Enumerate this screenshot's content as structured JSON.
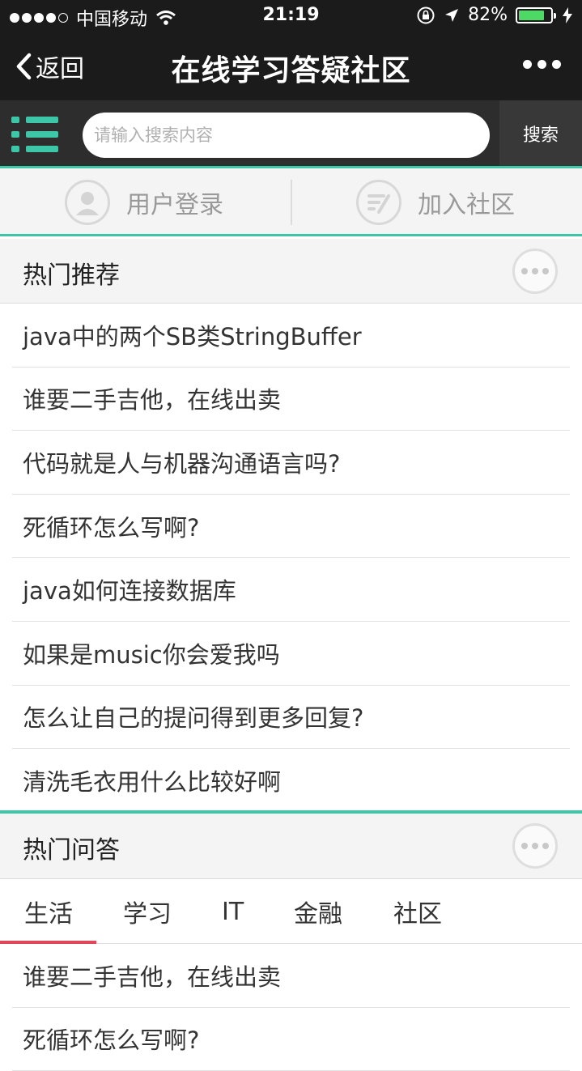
{
  "status_bar": {
    "carrier": "中国移动",
    "time": "21:19",
    "battery_text": "82%",
    "battery_level": 0.82,
    "signal_icons": [
      "signal-dots-icon",
      "wifi-icon"
    ],
    "right_icons": [
      "rotation-lock-icon",
      "location-arrow-icon",
      "battery-icon",
      "charging-bolt-icon"
    ]
  },
  "nav": {
    "back_label": "返回",
    "title": "在线学习答疑社区"
  },
  "search": {
    "placeholder": "请输入搜索内容",
    "value": "",
    "button_label": "搜索"
  },
  "actions": {
    "login_label": "用户登录",
    "join_label": "加入社区"
  },
  "hot_recommend": {
    "title": "热门推荐",
    "items": [
      "java中的两个SB类StringBuffer",
      "谁要二手吉他，在线出卖",
      "代码就是人与机器沟通语言吗?",
      "死循环怎么写啊?",
      "java如何连接数据库",
      "如果是music你会爱我吗",
      "怎么让自己的提问得到更多回复?",
      "清洗毛衣用什么比较好啊"
    ]
  },
  "hot_qa": {
    "title": "热门问答",
    "tabs": [
      "生活",
      "学习",
      "IT",
      "金融",
      "社区"
    ],
    "active_tab": "生活",
    "items": [
      "谁要二手吉他，在线出卖",
      "死循环怎么写啊?"
    ]
  },
  "colors": {
    "accent": "#3ec6a8",
    "bar_dark": "#1b1b1b",
    "tab_active": "#e0485a",
    "battery": "#4cd964"
  }
}
